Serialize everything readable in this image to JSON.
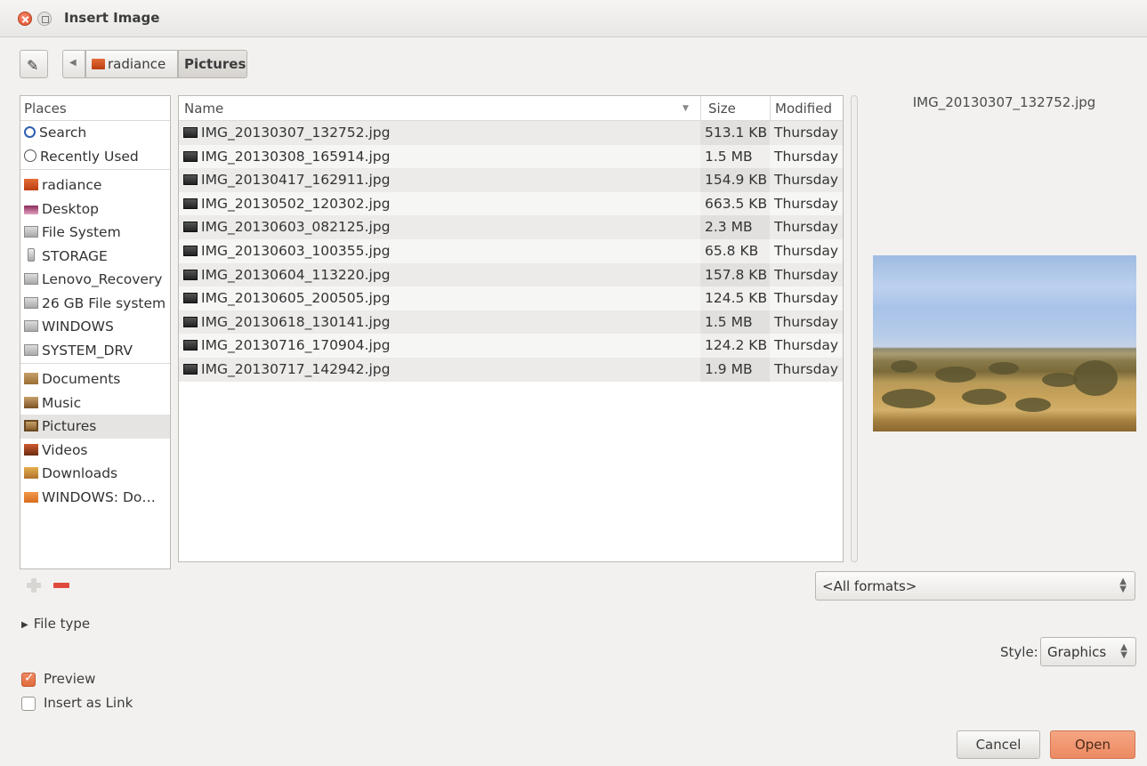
{
  "window": {
    "title": "Insert Image"
  },
  "pathbar": {
    "crumbs": [
      "radiance",
      "Pictures"
    ]
  },
  "places": {
    "header": "Places",
    "items": [
      "Search",
      "Recently Used",
      "radiance",
      "Desktop",
      "File System",
      "STORAGE",
      "Lenovo_Recovery",
      "26 GB File system",
      "WINDOWS",
      "SYSTEM_DRV",
      "Documents",
      "Music",
      "Pictures",
      "Videos",
      "Downloads",
      "WINDOWS: Do…"
    ]
  },
  "filelist": {
    "columns": {
      "name": "Name",
      "size": "Size",
      "modified": "Modified"
    },
    "rows": [
      {
        "name": "IMG_20130307_132752.jpg",
        "size": "513.1 KB",
        "modified": "Thursday"
      },
      {
        "name": "IMG_20130308_165914.jpg",
        "size": "1.5 MB",
        "modified": "Thursday"
      },
      {
        "name": "IMG_20130417_162911.jpg",
        "size": "154.9 KB",
        "modified": "Thursday"
      },
      {
        "name": "IMG_20130502_120302.jpg",
        "size": "663.5 KB",
        "modified": "Thursday"
      },
      {
        "name": "IMG_20130603_082125.jpg",
        "size": "2.3 MB",
        "modified": "Thursday"
      },
      {
        "name": "IMG_20130603_100355.jpg",
        "size": "65.8 KB",
        "modified": "Thursday"
      },
      {
        "name": "IMG_20130604_113220.jpg",
        "size": "157.8 KB",
        "modified": "Thursday"
      },
      {
        "name": "IMG_20130605_200505.jpg",
        "size": "124.5 KB",
        "modified": "Thursday"
      },
      {
        "name": "IMG_20130618_130141.jpg",
        "size": "1.5 MB",
        "modified": "Thursday"
      },
      {
        "name": "IMG_20130716_170904.jpg",
        "size": "124.2 KB",
        "modified": "Thursday"
      },
      {
        "name": "IMG_20130717_142942.jpg",
        "size": "1.9 MB",
        "modified": "Thursday"
      }
    ]
  },
  "preview": {
    "filename": "IMG_20130307_132752.jpg"
  },
  "filter": {
    "selected": "<All formats>"
  },
  "filetype": {
    "label": "File type"
  },
  "style": {
    "label": "Style:",
    "value": "Graphics"
  },
  "options": {
    "preview_label": "Preview",
    "preview_checked": true,
    "link_label": "Insert as Link",
    "link_checked": false
  },
  "buttons": {
    "cancel": "Cancel",
    "open": "Open"
  },
  "colors": {
    "accent": "#ec8a62",
    "remove": "#df4a3c"
  }
}
